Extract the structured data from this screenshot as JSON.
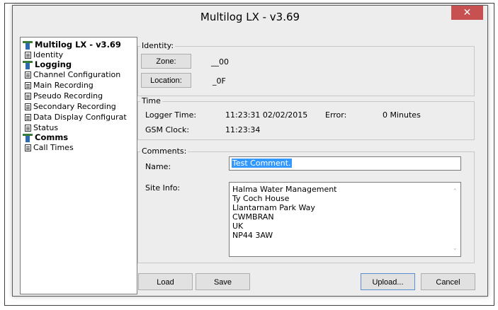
{
  "window": {
    "title": "Multilog LX - v3.69",
    "close_label": "✕"
  },
  "tree": {
    "items": [
      {
        "label": "Multilog LX - v3.69",
        "group": true
      },
      {
        "label": "Identity",
        "group": false
      },
      {
        "label": "Logging",
        "group": true
      },
      {
        "label": "Channel Configuration",
        "group": false
      },
      {
        "label": "Main Recording",
        "group": false
      },
      {
        "label": "Pseudo Recording",
        "group": false
      },
      {
        "label": "Secondary Recording",
        "group": false
      },
      {
        "label": "Data Display Configurat",
        "group": false
      },
      {
        "label": "Status",
        "group": false
      },
      {
        "label": "Comms",
        "group": true
      },
      {
        "label": "Call Times",
        "group": false
      }
    ]
  },
  "identity": {
    "title": "Identity:",
    "zone_button": "Zone:",
    "zone_value": "__00",
    "location_button": "Location:",
    "location_value": "_0F"
  },
  "time": {
    "title": "Time",
    "logger_time_label": "Logger Time:",
    "logger_time_value": "11:23:31  02/02/2015",
    "error_label": "Error:",
    "error_value": "0 Minutes",
    "gsm_label": "GSM Clock:",
    "gsm_value": "11:23:34"
  },
  "comments": {
    "title": "Comments:",
    "name_label": "Name:",
    "name_value": "Test Comment.",
    "site_label": "Site Info:",
    "site_lines": [
      "Halma Water Management",
      "Ty Coch House",
      "Llantarnam Park Way",
      "CWMBRAN",
      "UK",
      "NP44 3AW"
    ]
  },
  "buttons": {
    "load": "Load",
    "save": "Save",
    "upload": "Upload...",
    "cancel": "Cancel"
  }
}
